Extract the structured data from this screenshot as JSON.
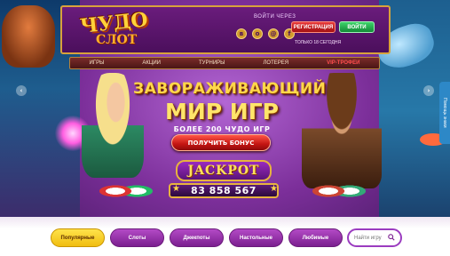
{
  "logo": {
    "top": "ЧУДО",
    "bottom": "СЛОТ"
  },
  "header": {
    "login_label": "ВОЙТИ ЧЕРЕЗ",
    "socials": [
      "vk-icon",
      "odnoklassniki-icon",
      "mailru-icon",
      "facebook-icon"
    ],
    "register_label": "РЕГИСТРАЦИЯ",
    "login_button": "ВОЙТИ",
    "register_note": "ТОЛЬКО 18 СЕГОДНЯ"
  },
  "nav": {
    "items": [
      "ИГРЫ",
      "АКЦИИ",
      "ТУРНИРЫ",
      "ЛОТЕРЕЯ",
      "VIP-ТРОФЕИ"
    ]
  },
  "banner": {
    "line1": "ЗАВОРАЖИВАЮЩИЙ",
    "line2": "МИР ИГР",
    "line3": "БОЛЕЕ 200 ЧУДО ИГР",
    "bonus_button": "ПОЛУЧИТЬ БОНУС",
    "jackpot_label": "JACKPOT",
    "jackpot_amount": "83 858 567"
  },
  "help_tab": "Помощь знаки",
  "categories": {
    "tabs": [
      "Популярные",
      "Слоты",
      "Джекпоты",
      "Настольные",
      "Любимые"
    ],
    "active_index": 0
  },
  "search": {
    "placeholder": "Найти игру"
  },
  "colors": {
    "accent_purple": "#7a1f8f",
    "active_tab": "#f0bd10",
    "register_red": "#c31512",
    "login_green": "#128a36",
    "gold": "#e7b33e"
  }
}
